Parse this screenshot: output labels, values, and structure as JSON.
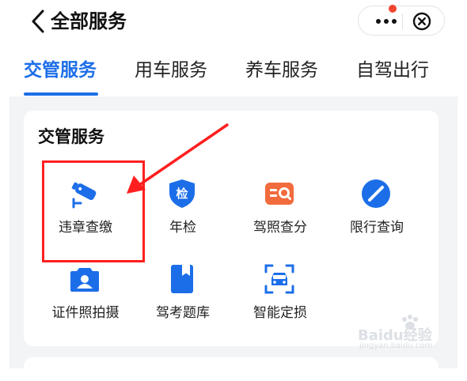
{
  "header": {
    "title": "全部服务",
    "icons": {
      "back": "chevron-left-icon",
      "more": "more-dots-icon",
      "close": "close-circle-icon"
    },
    "notification_dot_color": "#f0452f"
  },
  "tabs": [
    {
      "label": "交管服务",
      "active": true
    },
    {
      "label": "用车服务",
      "active": false
    },
    {
      "label": "养车服务",
      "active": false
    },
    {
      "label": "自驾出行",
      "active": false
    }
  ],
  "section": {
    "title": "交管服务",
    "items": [
      {
        "label": "违章查缴",
        "icon": "traffic-camera-icon",
        "highlighted": true
      },
      {
        "label": "年检",
        "icon": "inspection-shield-icon",
        "badge": "检"
      },
      {
        "label": "驾照查分",
        "icon": "license-search-icon"
      },
      {
        "label": "限行查询",
        "icon": "no-entry-icon"
      },
      {
        "label": "证件照拍摄",
        "icon": "camera-person-icon"
      },
      {
        "label": "驾考题库",
        "icon": "bookmark-book-icon"
      },
      {
        "label": "智能定损",
        "icon": "car-scan-icon"
      }
    ]
  },
  "annotation": {
    "color": "#ff1f1f"
  },
  "watermark": {
    "text": "Baidu经验",
    "subtext": "jingyan.baidu.com"
  },
  "colors": {
    "accent": "#1c6ee8",
    "orange": "#f26b3c",
    "background": "#f3f4f6"
  }
}
